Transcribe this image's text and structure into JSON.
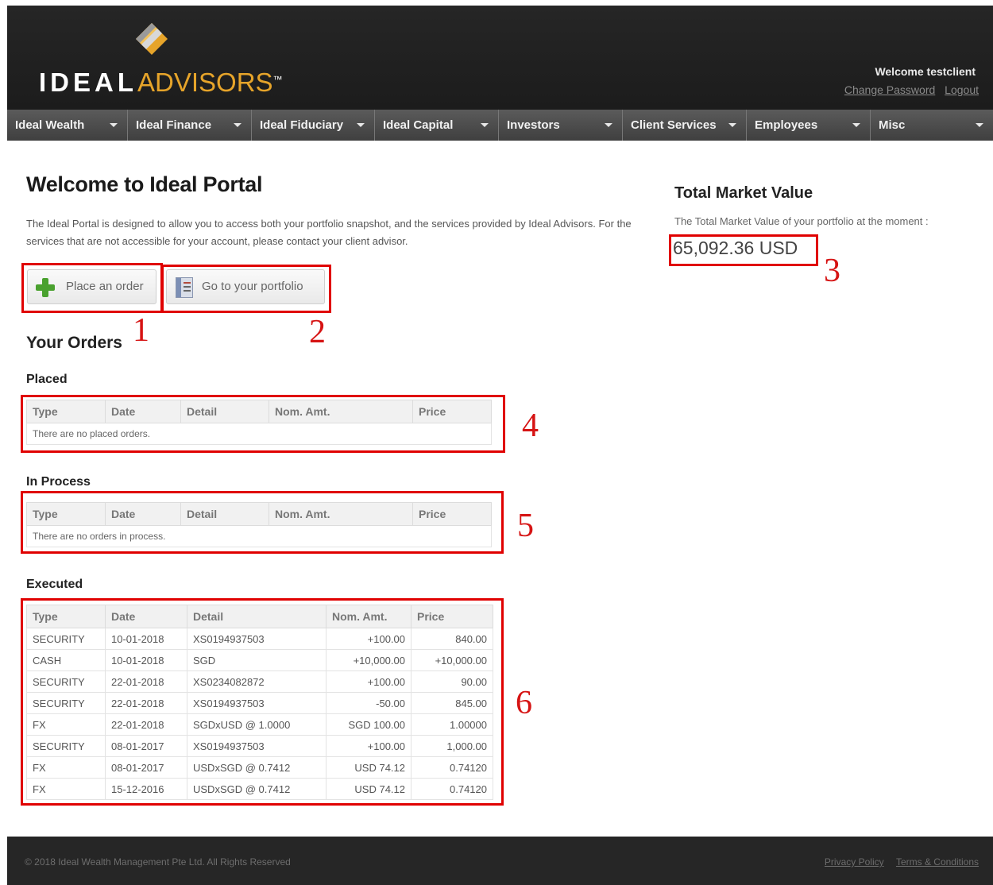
{
  "header": {
    "logo_ideal": "IDEAL",
    "logo_advisors": "ADVISORS",
    "logo_tm": "™",
    "welcome": "Welcome testclient",
    "change_password": "Change Password",
    "logout": "Logout"
  },
  "nav": {
    "items": [
      {
        "label": "Ideal Wealth"
      },
      {
        "label": "Ideal Finance"
      },
      {
        "label": "Ideal Fiduciary"
      },
      {
        "label": "Ideal Capital"
      },
      {
        "label": "Investors"
      },
      {
        "label": "Client Services"
      },
      {
        "label": "Employees"
      },
      {
        "label": "Misc"
      }
    ]
  },
  "main": {
    "title": "Welcome to Ideal Portal",
    "intro": "The Ideal Portal is designed to allow you to access both your portfolio snapshot, and the services provided by Ideal Advisors. For the services that are not accessible for your account, please contact your client advisor.",
    "place_order_label": "Place an order",
    "portfolio_label": "Go to your portfolio",
    "orders_title": "Your Orders",
    "columns": [
      "Type",
      "Date",
      "Detail",
      "Nom. Amt.",
      "Price"
    ],
    "placed": {
      "title": "Placed",
      "empty": "There are no placed orders."
    },
    "in_process": {
      "title": "In Process",
      "empty": "There are no orders in process."
    },
    "executed": {
      "title": "Executed",
      "rows": [
        [
          "SECURITY",
          "10-01-2018",
          "XS0194937503",
          "+100.00",
          "840.00"
        ],
        [
          "CASH",
          "10-01-2018",
          "SGD",
          "+10,000.00",
          "+10,000.00"
        ],
        [
          "SECURITY",
          "22-01-2018",
          "XS0234082872",
          "+100.00",
          "90.00"
        ],
        [
          "SECURITY",
          "22-01-2018",
          "XS0194937503",
          "-50.00",
          "845.00"
        ],
        [
          "FX",
          "22-01-2018",
          "SGDxUSD @ 1.0000",
          "SGD 100.00",
          "1.00000"
        ],
        [
          "SECURITY",
          "08-01-2017",
          "XS0194937503",
          "+100.00",
          "1,000.00"
        ],
        [
          "FX",
          "08-01-2017",
          "USDxSGD @ 0.7412",
          "USD 74.12",
          "0.74120"
        ],
        [
          "FX",
          "15-12-2016",
          "USDxSGD @ 0.7412",
          "USD 74.12",
          "0.74120"
        ]
      ]
    }
  },
  "market_value": {
    "title": "Total Market Value",
    "desc": "The Total Market Value of your portfolio at the moment :",
    "value": "65,092.36 USD"
  },
  "annotations": [
    "1",
    "2",
    "3",
    "4",
    "5",
    "6"
  ],
  "footer": {
    "copyright": "© 2018 Ideal Wealth Management Pte Ltd. All Rights Reserved",
    "privacy": "Privacy Policy",
    "terms": "Terms & Conditions"
  },
  "colors": {
    "accent": "#e6a42a",
    "annotation": "#e00000",
    "header_bg": "#262626",
    "nav_bg": "#4a4a4a"
  }
}
